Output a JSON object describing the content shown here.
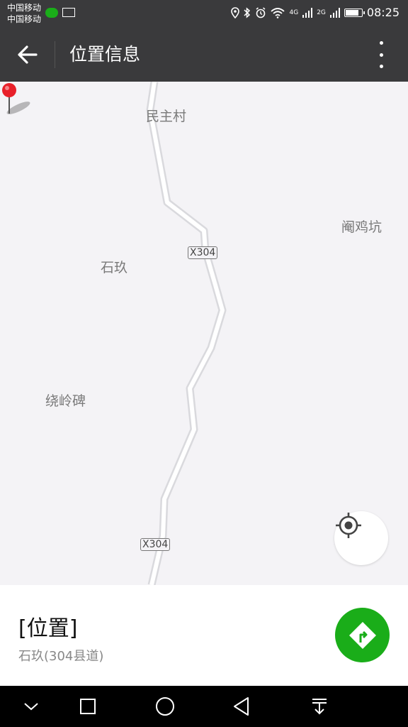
{
  "status_bar": {
    "carrier_1": "中国移动",
    "carrier_2": "中国移动",
    "time": "08:25",
    "net_1": "4G",
    "net_2": "2G",
    "icons": [
      "wechat-icon",
      "mail-icon",
      "location-icon",
      "bluetooth-icon",
      "alarm-icon",
      "wifi-icon",
      "signal-icon",
      "battery-icon"
    ]
  },
  "header": {
    "title": "位置信息",
    "back_icon": "arrow-left-icon",
    "more_icon": "more-vertical-icon"
  },
  "map": {
    "places": [
      "民主村",
      "阉鸡坑",
      "石玖",
      "绕岭碑"
    ],
    "road_labels": [
      "X304",
      "X304"
    ],
    "pin_color": "#e8202a"
  },
  "location": {
    "title": "[位置]",
    "address": "石玖(304县道)"
  },
  "colors": {
    "bar_bg": "#3a3a3c",
    "accent_green": "#1aad19"
  },
  "nav_bar": {
    "icons": [
      "chevron-down-icon",
      "square-icon",
      "circle-icon",
      "triangle-back-icon",
      "pull-down-icon"
    ]
  }
}
